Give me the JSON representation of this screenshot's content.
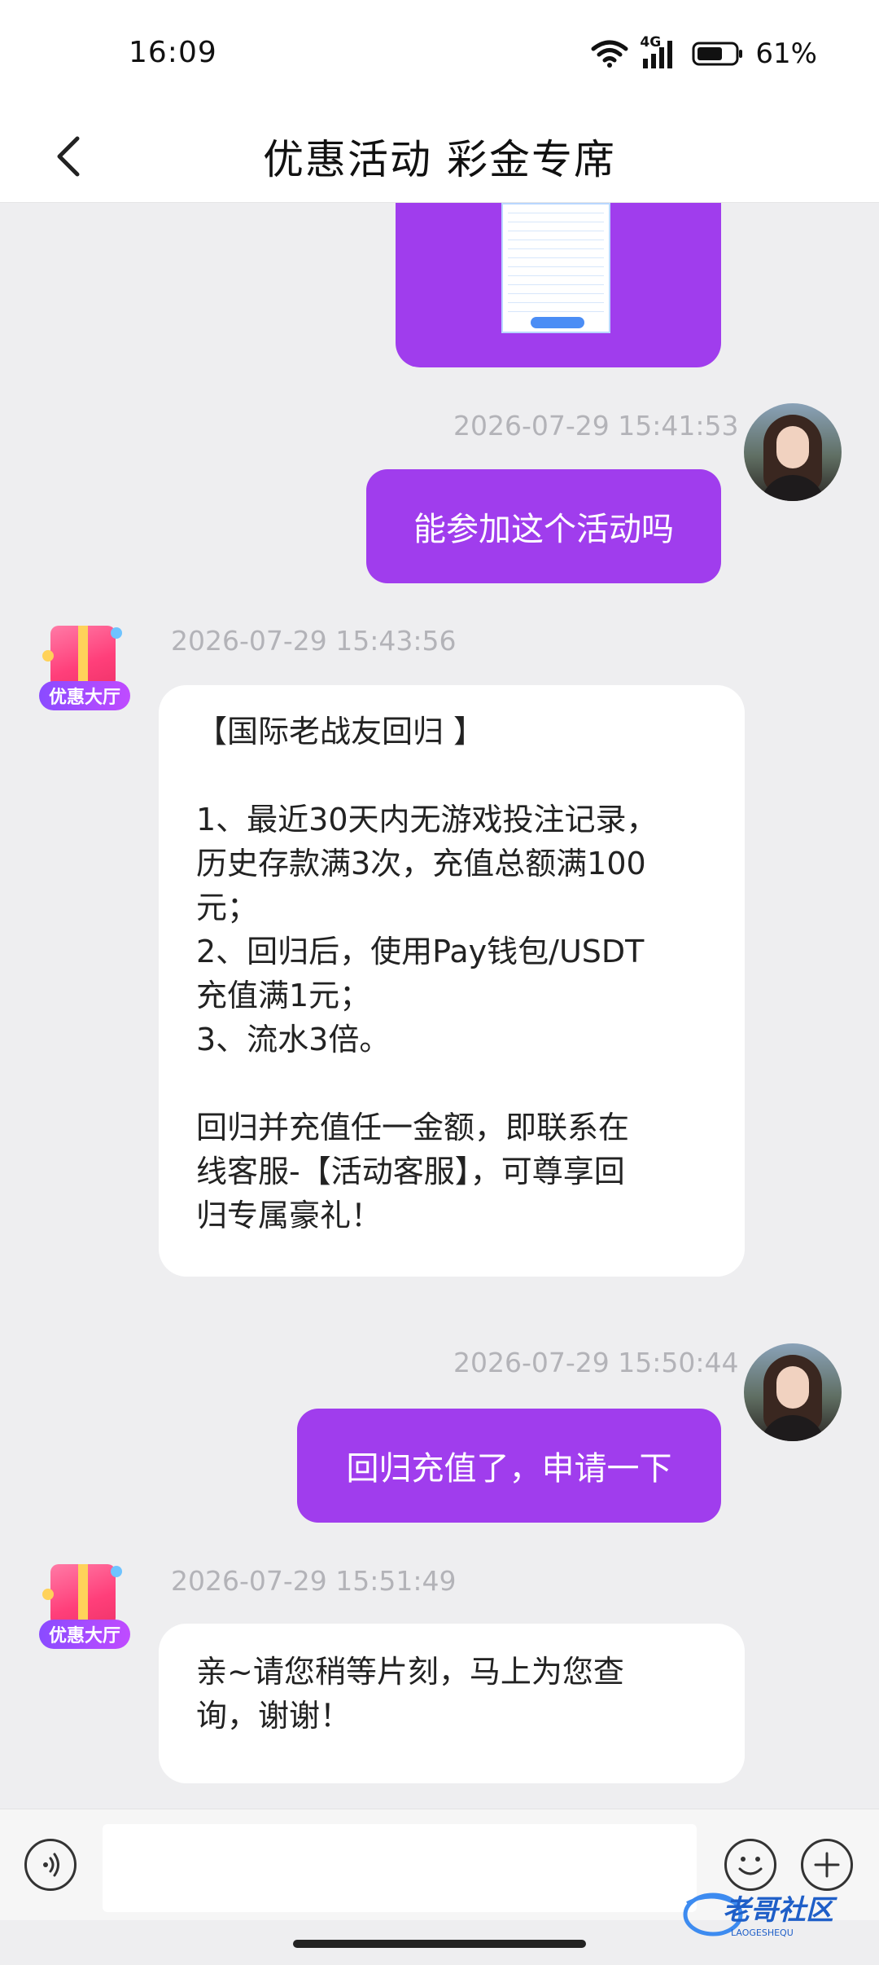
{
  "status_bar": {
    "time": "16:09",
    "network": "4G",
    "battery": "61%",
    "icons": [
      "wifi-icon",
      "signal-icon",
      "battery-icon"
    ]
  },
  "header": {
    "back_icon": "back-arrow-icon",
    "title": "优惠活动  彩金专席"
  },
  "messages": [
    {
      "type": "image",
      "side": "outgoing",
      "icon": "activity-poster-thumbnail"
    },
    {
      "side": "outgoing",
      "timestamp": "2026-07-29 15:41:53",
      "text": "能参加这个活动吗"
    },
    {
      "side": "incoming",
      "timestamp": "2026-07-29 15:43:56",
      "sender_badge": "优惠大厅",
      "text": "【国际老战友回归 】\n\n1、最近30天内无游戏投注记录，\n历史存款满3次，充值总额满100\n元；\n2、回归后，使用Pay钱包/USDT\n充值满1元；\n3、流水3倍。\n\n回归并充值任一金额，即联系在\n线客服-【活动客服】，可尊享回\n归专属豪礼！"
    },
    {
      "side": "outgoing",
      "timestamp": "2026-07-29 15:50:44",
      "text": "回归充值了，申请一下"
    },
    {
      "side": "incoming",
      "timestamp": "2026-07-29 15:51:49",
      "sender_badge": "优惠大厅",
      "text": "亲~请您稍等片刻，马上为您查\n询，谢谢！"
    }
  ],
  "input_bar": {
    "voice_icon": "voice-icon",
    "placeholder": "",
    "value": "",
    "emoji_icon": "emoji-icon",
    "plus_icon": "plus-icon"
  },
  "watermark": {
    "text": "老哥社区",
    "sub": "LAOGESHEQU"
  },
  "colors": {
    "accent": "#a03ded",
    "background": "#eeeef0",
    "incoming_bubble": "#ffffff",
    "timestamp": "#b3b3b8"
  }
}
